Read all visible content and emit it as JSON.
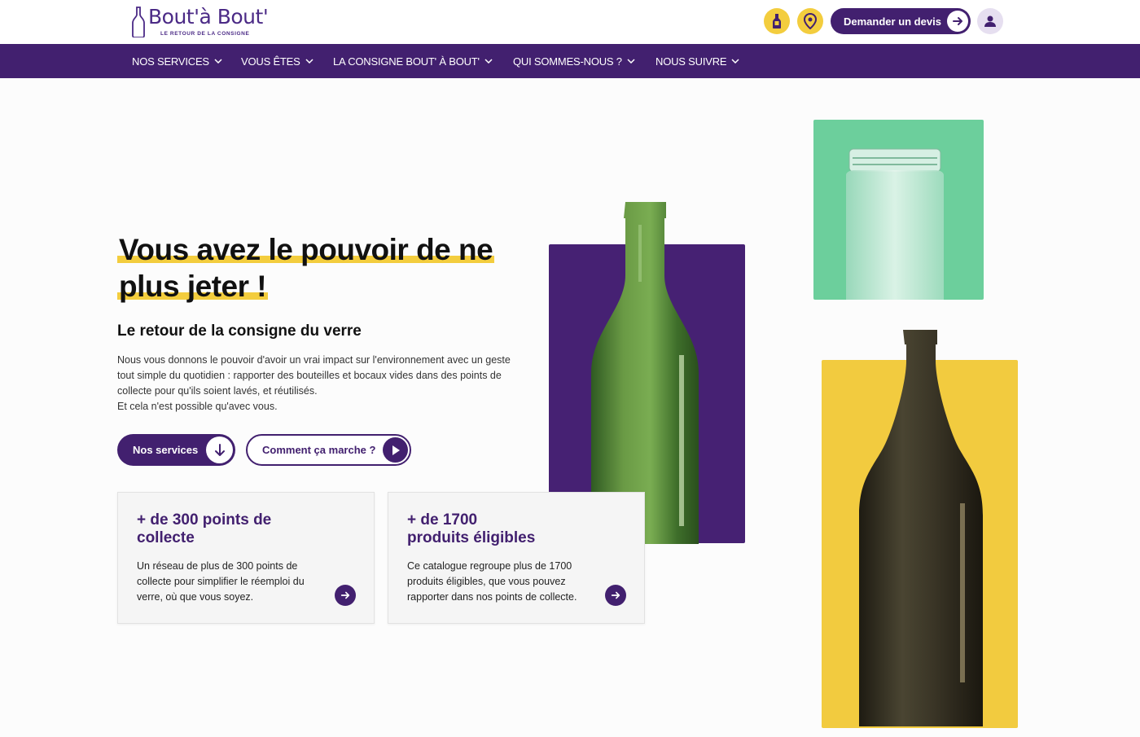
{
  "brand": {
    "name": "Bout'à Bout'",
    "tagline": "LE RETOUR DE LA CONSIGNE",
    "color_primary": "#42206f",
    "color_yellow": "#f3cd3e",
    "color_green": "#6ccf9c"
  },
  "header": {
    "icons": [
      "bottle-icon",
      "location-pin-icon",
      "user-icon"
    ],
    "devis_label": "Demander un devis"
  },
  "nav": {
    "items": [
      {
        "label": "NOS SERVICES"
      },
      {
        "label": "VOUS ÊTES"
      },
      {
        "label": "LA CONSIGNE BOUT' À BOUT'"
      },
      {
        "label": "QUI SOMMES-NOUS ?"
      },
      {
        "label": "NOUS SUIVRE"
      }
    ]
  },
  "hero": {
    "title_line1": "Vous avez le pouvoir de ne",
    "title_line2": "plus jeter !",
    "subtitle": "Le retour de la consigne du verre",
    "description": "Nous vous donnons le pouvoir d'avoir un vrai impact sur l'environnement avec un geste tout simple du quotidien : rapporter des bouteilles et bocaux vides dans des points de collecte pour qu'ils soient lavés, et réutilisés.",
    "description_2": "Et cela n'est possible qu'avec vous.",
    "btn_primary": "Nos services",
    "btn_secondary": "Comment ça marche ?"
  },
  "cards": [
    {
      "title": "+ de 300 points de collecte",
      "text": "Un réseau de plus de 300 points de collecte pour simplifier le réemploi du verre, où que vous soyez."
    },
    {
      "title_line1": "+ de 1700",
      "title_line2": "produits éligibles",
      "text": "Ce catalogue regroupe plus de 1700 produits éligibles, que vous pouvez rapporter dans nos points de collecte."
    }
  ]
}
